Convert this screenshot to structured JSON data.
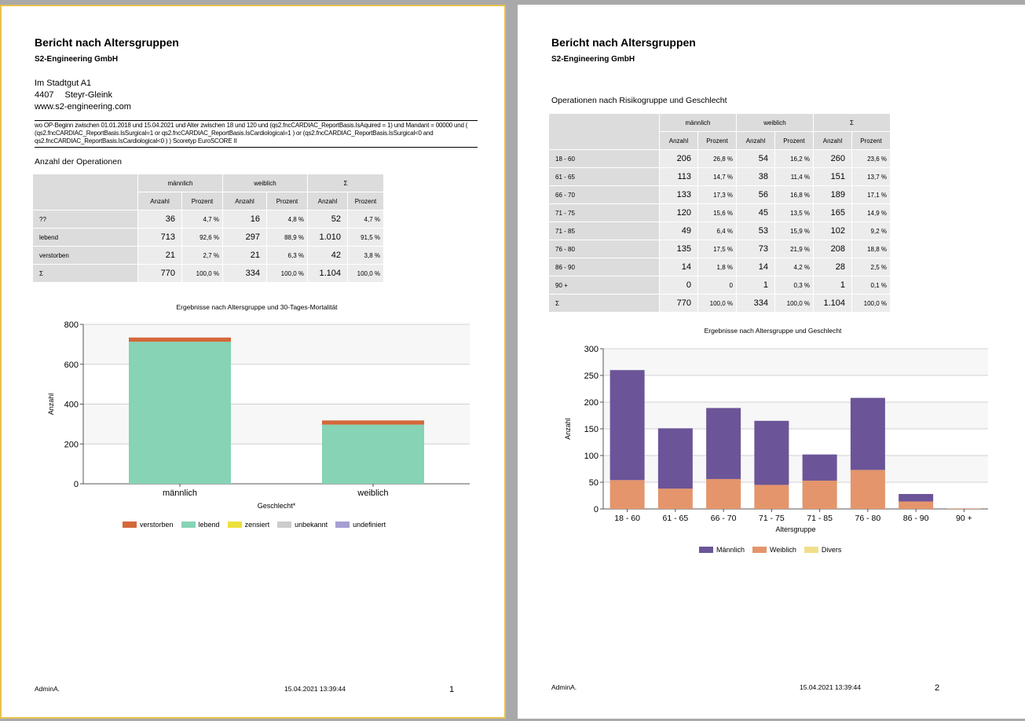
{
  "report_title": "Bericht nach Altersgruppen",
  "company": "S2-Engineering GmbH",
  "address": {
    "street": "Im Stadtgut A1",
    "zip": "4407",
    "city": "Steyr-Gleink",
    "web": "www.s2-engineering.com"
  },
  "filter_text": "wo OP-Beginn zwischen 01.01.2018 und 15.04.2021 und Alter zwischen 18 und 120 und (qs2.fncCARDIAC_ReportBasis.IsAquired = 1) und Mandant = 00000 und ( (qs2.fncCARDIAC_ReportBasis.IsSurgical=1 or qs2.fncCARDIAC_ReportBasis.IsCardiological=1 ) or (qs2.fncCARDIAC_ReportBasis.IsSurgical<0 and qs2.fncCARDIAC_ReportBasis.IsCardiological<0 ) ) Scoretyp EuroSCORE II",
  "headers": {
    "male": "männlich",
    "female": "weiblich",
    "sum": "Σ",
    "count": "Anzahl",
    "percent": "Prozent"
  },
  "table1": {
    "section_title": "Anzahl der Operationen",
    "rows": [
      {
        "label": "??",
        "m_n": "36",
        "m_p": "4,7 %",
        "w_n": "16",
        "w_p": "4,8 %",
        "s_n": "52",
        "s_p": "4,7 %"
      },
      {
        "label": "lebend",
        "m_n": "713",
        "m_p": "92,6 %",
        "w_n": "297",
        "w_p": "88,9 %",
        "s_n": "1.010",
        "s_p": "91,5 %"
      },
      {
        "label": "verstorben",
        "m_n": "21",
        "m_p": "2,7 %",
        "w_n": "21",
        "w_p": "6,3 %",
        "s_n": "42",
        "s_p": "3,8 %"
      },
      {
        "label": "Σ",
        "m_n": "770",
        "m_p": "100,0 %",
        "w_n": "334",
        "w_p": "100,0 %",
        "s_n": "1.104",
        "s_p": "100,0 %"
      }
    ]
  },
  "table2": {
    "section_title": "Operationen nach Risikogruppe und Geschlecht",
    "rows": [
      {
        "label": "18 - 60",
        "m_n": "206",
        "m_p": "26,8 %",
        "w_n": "54",
        "w_p": "16,2 %",
        "s_n": "260",
        "s_p": "23,6 %"
      },
      {
        "label": "61 - 65",
        "m_n": "113",
        "m_p": "14,7 %",
        "w_n": "38",
        "w_p": "11,4 %",
        "s_n": "151",
        "s_p": "13,7 %"
      },
      {
        "label": "66 - 70",
        "m_n": "133",
        "m_p": "17,3 %",
        "w_n": "56",
        "w_p": "16,8 %",
        "s_n": "189",
        "s_p": "17,1 %"
      },
      {
        "label": "71 - 75",
        "m_n": "120",
        "m_p": "15,6 %",
        "w_n": "45",
        "w_p": "13,5 %",
        "s_n": "165",
        "s_p": "14,9 %"
      },
      {
        "label": "71 - 85",
        "m_n": "49",
        "m_p": "6,4 %",
        "w_n": "53",
        "w_p": "15,9 %",
        "s_n": "102",
        "s_p": "9,2 %"
      },
      {
        "label": "76 - 80",
        "m_n": "135",
        "m_p": "17,5 %",
        "w_n": "73",
        "w_p": "21,9 %",
        "s_n": "208",
        "s_p": "18,8 %"
      },
      {
        "label": "86 - 90",
        "m_n": "14",
        "m_p": "1,8 %",
        "w_n": "14",
        "w_p": "4,2 %",
        "s_n": "28",
        "s_p": "2,5 %"
      },
      {
        "label": "90 +",
        "m_n": "0",
        "m_p": "0",
        "w_n": "1",
        "w_p": "0,3 %",
        "s_n": "1",
        "s_p": "0,1 %"
      },
      {
        "label": "Σ",
        "m_n": "770",
        "m_p": "100,0 %",
        "w_n": "334",
        "w_p": "100,0 %",
        "s_n": "1.104",
        "s_p": "100,0 %"
      }
    ]
  },
  "chart_data": [
    {
      "type": "bar",
      "stacked": true,
      "title": "Ergebnisse nach Altersgruppe und 30-Tages-Mortalität",
      "xlabel": "Geschlecht*",
      "ylabel": "Anzahl",
      "categories": [
        "männlich",
        "weiblich"
      ],
      "ylim": [
        0,
        800
      ],
      "yticks": [
        0,
        200,
        400,
        600,
        800
      ],
      "grid": true,
      "legend_position": "bottom",
      "series": [
        {
          "name": "verstorben",
          "color": "#d4683a",
          "values": [
            21,
            21
          ]
        },
        {
          "name": "lebend",
          "color": "#86d3b5",
          "values": [
            713,
            297
          ]
        },
        {
          "name": "zensiert",
          "color": "#ece03d",
          "values": [
            0,
            0
          ]
        },
        {
          "name": "unbekannt",
          "color": "#cccccc",
          "values": [
            0,
            0
          ]
        },
        {
          "name": "undefiniert",
          "color": "#a59fd3",
          "values": [
            0,
            0
          ]
        }
      ],
      "stack_order": [
        "lebend",
        "verstorben",
        "zensiert",
        "unbekannt",
        "undefiniert"
      ]
    },
    {
      "type": "bar",
      "stacked": true,
      "title": "Ergebnisse nach Altersgruppe und Geschlecht",
      "xlabel": "Altersgruppe",
      "ylabel": "Anzahl",
      "categories": [
        "18 - 60",
        "61 - 65",
        "66 - 70",
        "71 - 75",
        "71 - 85",
        "76 - 80",
        "86 - 90",
        "90 +"
      ],
      "ylim": [
        0,
        300
      ],
      "yticks": [
        0,
        50,
        100,
        150,
        200,
        250,
        300
      ],
      "grid": true,
      "legend_position": "bottom",
      "series": [
        {
          "name": "Männlich",
          "color": "#6b5598",
          "values": [
            206,
            113,
            133,
            120,
            49,
            135,
            14,
            0
          ]
        },
        {
          "name": "Weiblich",
          "color": "#e4956b",
          "values": [
            54,
            38,
            56,
            45,
            53,
            73,
            14,
            1
          ]
        },
        {
          "name": "Divers",
          "color": "#f1de8a",
          "values": [
            0,
            0,
            0,
            0,
            0,
            0,
            0,
            0
          ]
        }
      ],
      "stack_order": [
        "Weiblich",
        "Männlich",
        "Divers"
      ]
    }
  ],
  "footer": {
    "user": "AdminA.",
    "datetime": "15.04.2021 13:39:44",
    "page1": "1",
    "page2": "2"
  }
}
